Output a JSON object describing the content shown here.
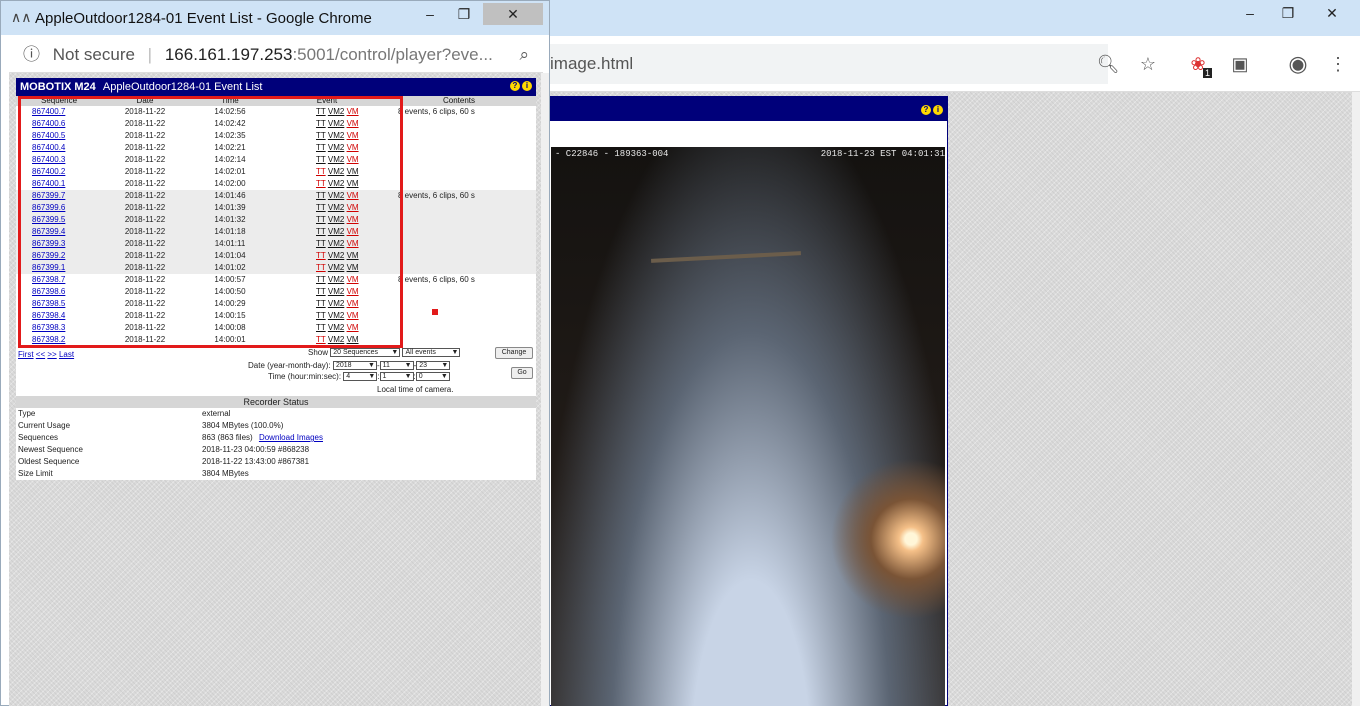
{
  "popup": {
    "window_title": "AppleOutdoor1284-01 Event List - Google Chrome",
    "security_label": "Not secure",
    "url_host": "166.161.197.253",
    "url_rest": ":5001/control/player?eve...",
    "header": {
      "brand": "MOBOTIX M24",
      "title": "AppleOutdoor1284-01 Event List"
    },
    "columns": {
      "sequence": "Sequence",
      "date": "Date",
      "time": "Time",
      "event": "Event",
      "contents": "Contents"
    },
    "event_links": {
      "tt": "TT",
      "vm2": "VM2",
      "vm": "VM"
    },
    "rows": [
      {
        "seq": "867400.7",
        "date": "2018-11-22",
        "time": "14:02:56",
        "contents": "8 events, 6 clips, 60 s"
      },
      {
        "seq": "867400.6",
        "date": "2018-11-22",
        "time": "14:02:42",
        "contents": ""
      },
      {
        "seq": "867400.5",
        "date": "2018-11-22",
        "time": "14:02:35",
        "contents": ""
      },
      {
        "seq": "867400.4",
        "date": "2018-11-22",
        "time": "14:02:21",
        "contents": ""
      },
      {
        "seq": "867400.3",
        "date": "2018-11-22",
        "time": "14:02:14",
        "contents": ""
      },
      {
        "seq": "867400.2",
        "date": "2018-11-22",
        "time": "14:02:01",
        "contents": ""
      },
      {
        "seq": "867400.1",
        "date": "2018-11-22",
        "time": "14:02:00",
        "contents": ""
      },
      {
        "seq": "867399.7",
        "date": "2018-11-22",
        "time": "14:01:46",
        "contents": "8 events, 6 clips, 60 s"
      },
      {
        "seq": "867399.6",
        "date": "2018-11-22",
        "time": "14:01:39",
        "contents": ""
      },
      {
        "seq": "867399.5",
        "date": "2018-11-22",
        "time": "14:01:32",
        "contents": ""
      },
      {
        "seq": "867399.4",
        "date": "2018-11-22",
        "time": "14:01:18",
        "contents": ""
      },
      {
        "seq": "867399.3",
        "date": "2018-11-22",
        "time": "14:01:11",
        "contents": ""
      },
      {
        "seq": "867399.2",
        "date": "2018-11-22",
        "time": "14:01:04",
        "contents": ""
      },
      {
        "seq": "867399.1",
        "date": "2018-11-22",
        "time": "14:01:02",
        "contents": ""
      },
      {
        "seq": "867398.7",
        "date": "2018-11-22",
        "time": "14:00:57",
        "contents": "8 events, 6 clips, 60 s"
      },
      {
        "seq": "867398.6",
        "date": "2018-11-22",
        "time": "14:00:50",
        "contents": ""
      },
      {
        "seq": "867398.5",
        "date": "2018-11-22",
        "time": "14:00:29",
        "contents": ""
      },
      {
        "seq": "867398.4",
        "date": "2018-11-22",
        "time": "14:00:15",
        "contents": ""
      },
      {
        "seq": "867398.3",
        "date": "2018-11-22",
        "time": "14:00:08",
        "contents": ""
      },
      {
        "seq": "867398.2",
        "date": "2018-11-22",
        "time": "14:00:01",
        "contents": ""
      }
    ],
    "controls": {
      "first": "First",
      "prev": "<<",
      "next": ">>",
      "last": "Last",
      "show_label": "Show",
      "show_value": "20 Sequences",
      "events_value": "All events",
      "change_button": "Change",
      "date_label": "Date (year-month-day):",
      "year": "2018",
      "month": "11",
      "day": "23",
      "time_label": "Time (hour:min:sec):",
      "hour": "4",
      "min": "1",
      "sec": "0",
      "go_button": "Go",
      "local_time_note": "Local time of camera."
    },
    "recorder_status": {
      "title": "Recorder Status",
      "rows": [
        {
          "k": "Type",
          "v": "external"
        },
        {
          "k": "Current Usage",
          "v": "3804 MBytes (100.0%)"
        },
        {
          "k": "Sequences",
          "v": "863 (863 files)"
        },
        {
          "k": "Newest Sequence",
          "v": "2018-11-23 04:00:59 #868238"
        },
        {
          "k": "Oldest Sequence",
          "v": "2018-11-22 13:43:00 #867381"
        },
        {
          "k": "Size Limit",
          "v": "3804 MBytes"
        }
      ],
      "download_link": "Download Images"
    }
  },
  "background": {
    "url_partial": "image.html",
    "extension_badge": "1",
    "osd_left": "- C22846 - 189363-004",
    "osd_right": "2018-11-23 EST 04:01:31"
  }
}
